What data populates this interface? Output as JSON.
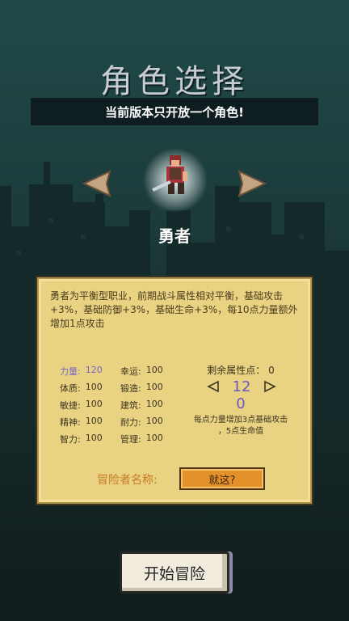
{
  "title": "角色选择",
  "banner": "当前版本只开放一个角色!",
  "hero": {
    "name": "勇者"
  },
  "panel": {
    "description": "勇者为平衡型职业，前期战斗属性相对平衡，基础攻击+3%，基础防御+3%，基础生命+3%，每10点力量额外增加1点攻击",
    "stats": [
      [
        {
          "label": "力量:",
          "value": "120"
        },
        {
          "label": "幸运:",
          "value": "100"
        }
      ],
      [
        {
          "label": "体质:",
          "value": "100"
        },
        {
          "label": "锻造:",
          "value": "100"
        }
      ],
      [
        {
          "label": "敏捷:",
          "value": "100"
        },
        {
          "label": "建筑:",
          "value": "100"
        }
      ],
      [
        {
          "label": "精神:",
          "value": "100"
        },
        {
          "label": "耐力:",
          "value": "100"
        }
      ],
      [
        {
          "label": "智力:",
          "value": "100"
        },
        {
          "label": "管理:",
          "value": "100"
        }
      ]
    ],
    "remaining_label": "剩余属性点： 0",
    "stepper_value": "12",
    "allocated": "0",
    "hint_line1": "每点力量增加3点基础攻击",
    "hint_line2": "，5点生命值",
    "name_label": "冒险者名称:",
    "name_button": "就这?"
  },
  "start_button": "开始冒险",
  "colors": {
    "highlight_stat": "#7a64c8",
    "panel_bg": "#e9d383",
    "name_button_bg": "#e3922b",
    "arrow": "#c4a482"
  }
}
